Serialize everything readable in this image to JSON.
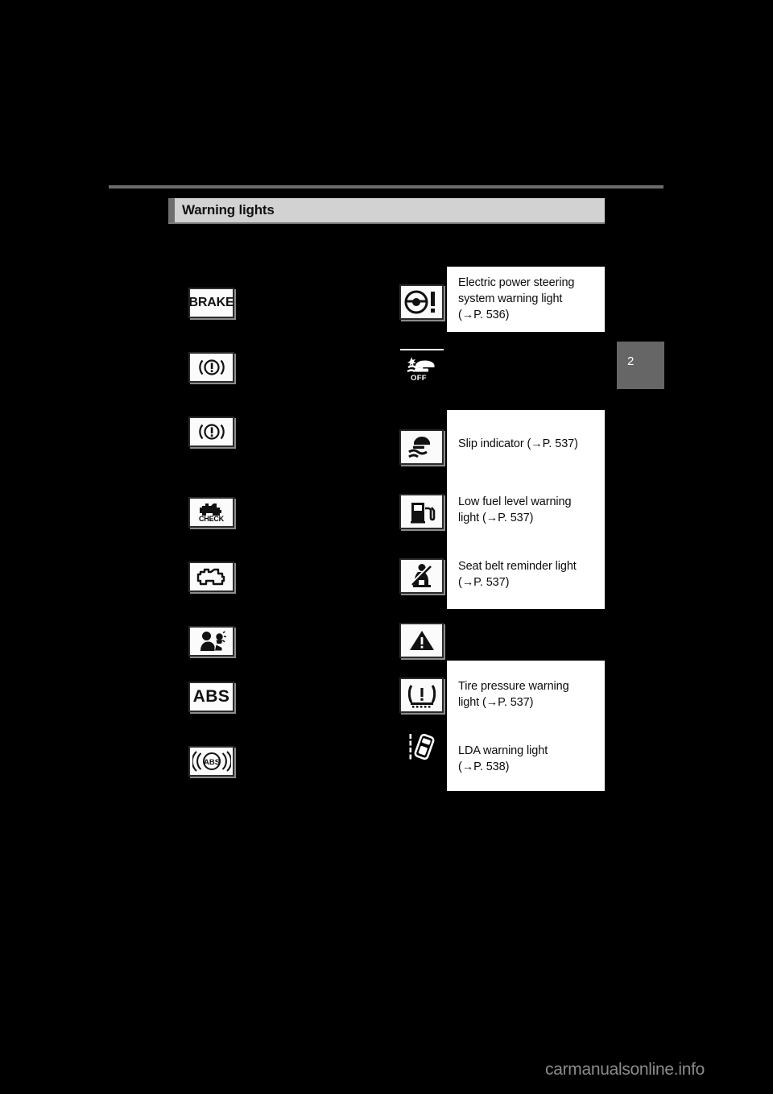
{
  "page": {
    "background_color": "#000000",
    "chapter_tab": {
      "number": "2",
      "color": "#666666"
    },
    "watermark": "carmanualsonline.info"
  },
  "header": {
    "title": "Warning lights",
    "accent_color": "#6e6e6e",
    "bar_color": "#d2d2d2",
    "rule_color": "#6b6b6b"
  },
  "left_column": {
    "items": [
      {
        "icon": "brake-warning-text-icon",
        "icon_label": "BRAKE",
        "caption": ""
      },
      {
        "icon": "brake-system-warning-icon",
        "icon_label": "",
        "caption": ""
      },
      {
        "icon": "brake-system-warning-icon-2",
        "icon_label": "",
        "caption": ""
      },
      {
        "icon": "engine-check-icon",
        "icon_label": "CHECK",
        "caption": ""
      },
      {
        "icon": "engine-malfunction-icon",
        "icon_label": "",
        "caption": ""
      },
      {
        "icon": "srs-airbag-warning-icon",
        "icon_label": "",
        "caption": ""
      },
      {
        "icon": "abs-warning-text-icon",
        "icon_label": "ABS",
        "caption": ""
      },
      {
        "icon": "abs-circle-warning-icon",
        "icon_label": "ABS",
        "caption": ""
      }
    ]
  },
  "right_column": {
    "items": [
      {
        "icon": "electric-power-steering-warning-icon",
        "caption": "Electric power steering system warning light (→P. 536)"
      },
      {
        "icon": "vsc-off-indicator-icon",
        "icon_label": "OFF",
        "caption": ""
      },
      {
        "icon": "slip-indicator-icon",
        "caption": "Slip indicator (→P. 537)"
      },
      {
        "icon": "low-fuel-level-warning-icon",
        "caption": "Low fuel level warning light (→P. 537)"
      },
      {
        "icon": "seat-belt-reminder-icon",
        "caption": "Seat belt reminder light (→P. 537)"
      },
      {
        "icon": "master-warning-triangle-icon",
        "caption": ""
      },
      {
        "icon": "tire-pressure-warning-icon",
        "caption": "Tire pressure warning light (→P. 537)"
      },
      {
        "icon": "lda-warning-icon",
        "caption": "LDA warning light (→P. 538)"
      }
    ]
  },
  "captions": {
    "eps_line1": "Electric power steering",
    "eps_line2": "system warning light",
    "eps_line3": "(→P. 536)",
    "slip_line1": "Slip indicator (→P. 537)",
    "fuel_line1": "Low fuel level warning",
    "fuel_line2": "light (→P. 537)",
    "belt_line1": "Seat belt reminder light",
    "belt_line2": "(→P. 537)",
    "tire_line1": "Tire pressure warning",
    "tire_line2": "light (→P. 537)",
    "lda_line1": "LDA warning light",
    "lda_line2": "(→P. 538)"
  },
  "icon_labels": {
    "brake": "BRAKE",
    "check": "CHECK",
    "abs": "ABS",
    "abs_small": "ABS",
    "off": "OFF"
  }
}
